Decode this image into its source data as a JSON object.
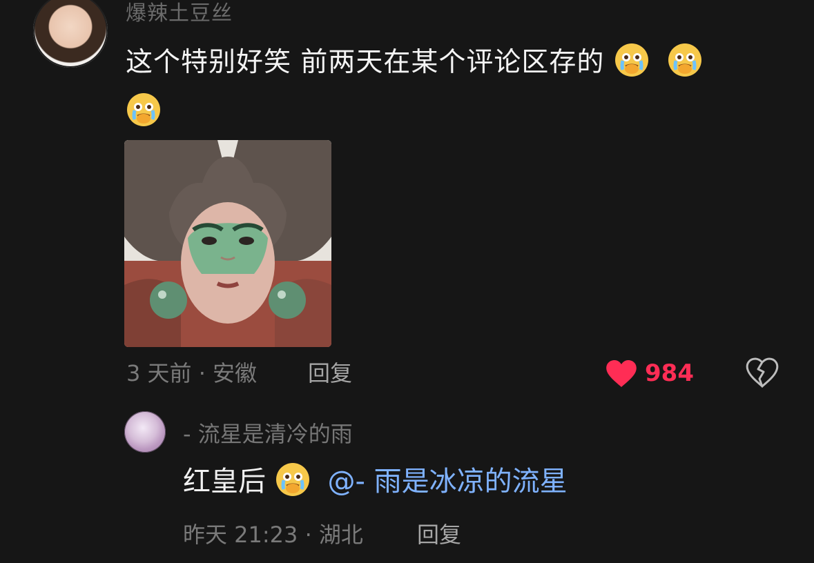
{
  "comment_main": {
    "username": "爆辣土豆丝",
    "text": "这个特别好笑 前两天在某个评论区存的",
    "meta": "3 天前 · 安徽",
    "reply_label": "回复",
    "like_count": "984"
  },
  "reply_comment": {
    "username": "- 流星是清冷的雨",
    "text": "红皇后",
    "mention": "@- 雨是冰凉的流星",
    "meta": "昨天 21:23 · 湖北",
    "reply_label": "回复"
  },
  "icons": {
    "emoji": "crying-face-emoji",
    "like": "heart-icon",
    "dislike": "broken-heart-icon"
  },
  "colors": {
    "background": "#161616",
    "like": "#ff2d55",
    "mention": "#7fb2ff"
  }
}
